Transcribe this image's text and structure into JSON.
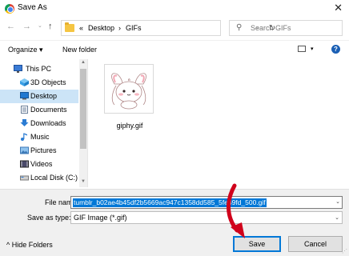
{
  "window": {
    "title": "Save As",
    "close": "✕"
  },
  "nav": {
    "back": "←",
    "forward": "→",
    "recent": "⌄",
    "up": "↑"
  },
  "address": {
    "prefix": "«",
    "crumbs": [
      "Desktop",
      "GIFs"
    ],
    "separator": "›",
    "dropdown": "⌄",
    "refresh": "↻"
  },
  "search": {
    "placeholder": "Search GIFs",
    "icon": "⚲"
  },
  "toolbar": {
    "organize": "Organize ▾",
    "new_folder": "New folder",
    "view_drop": "▾",
    "help": "?"
  },
  "sidebar": {
    "items": [
      {
        "label": "This PC",
        "icon": "pc-icon",
        "selected": false
      },
      {
        "label": "3D Objects",
        "icon": "cube-icon",
        "selected": false
      },
      {
        "label": "Desktop",
        "icon": "desktop-icon",
        "selected": true
      },
      {
        "label": "Documents",
        "icon": "document-icon",
        "selected": false
      },
      {
        "label": "Downloads",
        "icon": "download-icon",
        "selected": false
      },
      {
        "label": "Music",
        "icon": "music-icon",
        "selected": false
      },
      {
        "label": "Pictures",
        "icon": "pictures-icon",
        "selected": false
      },
      {
        "label": "Videos",
        "icon": "video-icon",
        "selected": false
      },
      {
        "label": "Local Disk (C:)",
        "icon": "disk-icon",
        "selected": false
      }
    ],
    "scroll_up": "▲",
    "scroll_down": "▼"
  },
  "files": [
    {
      "name": "giphy.gif"
    }
  ],
  "form": {
    "file_name_label": "File name:",
    "file_name_value": "tumblr_b02ae4b45df2b5669ac947c1358dd585_5fe89fd_500.gif",
    "type_label": "Save as type:",
    "type_value": "GIF Image (*.gif)",
    "dropdown": "⌄"
  },
  "footer": {
    "hide_folders": "^  Hide Folders",
    "save": "Save",
    "cancel": "Cancel",
    "grip": "⋰"
  },
  "colors": {
    "selection": "#0078d7",
    "sidebar_selected": "#cce4f7",
    "annotation_red": "#d0021b"
  }
}
